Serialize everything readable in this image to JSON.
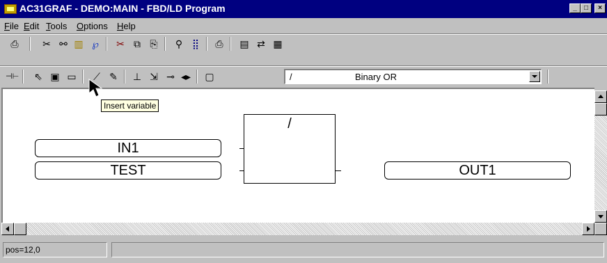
{
  "window": {
    "title": "AC31GRAF - DEMO:MAIN - FBD/LD Program"
  },
  "menu": [
    {
      "label": "File",
      "u": "F"
    },
    {
      "label": "Edit",
      "u": "E"
    },
    {
      "label": "Tools",
      "u": "T"
    },
    {
      "label": "Options",
      "u": "O"
    },
    {
      "label": "Help",
      "u": "H"
    }
  ],
  "block_selector": {
    "symbol": "/",
    "name": "Binary OR"
  },
  "tooltip": "Insert variable",
  "diagram": {
    "inputs": [
      "IN1",
      "TEST"
    ],
    "block_label": "/",
    "output": "OUT1"
  },
  "status": {
    "position": "pos=12,0"
  }
}
